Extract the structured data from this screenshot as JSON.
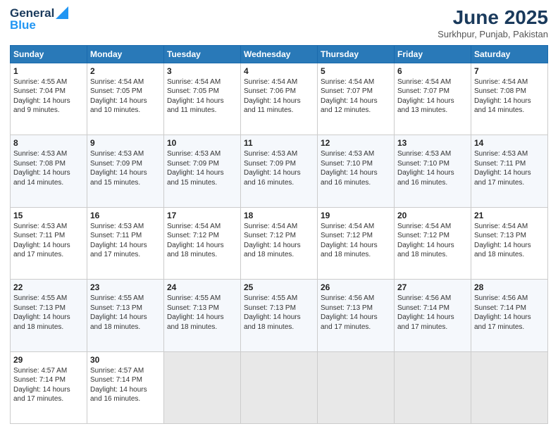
{
  "header": {
    "logo_line1": "General",
    "logo_line2": "Blue",
    "month": "June 2025",
    "location": "Surkhpur, Punjab, Pakistan"
  },
  "weekdays": [
    "Sunday",
    "Monday",
    "Tuesday",
    "Wednesday",
    "Thursday",
    "Friday",
    "Saturday"
  ],
  "weeks": [
    [
      {
        "day": "1",
        "sunrise": "4:55 AM",
        "sunset": "7:04 PM",
        "daylight": "14 hours and 9 minutes."
      },
      {
        "day": "2",
        "sunrise": "4:54 AM",
        "sunset": "7:05 PM",
        "daylight": "14 hours and 10 minutes."
      },
      {
        "day": "3",
        "sunrise": "4:54 AM",
        "sunset": "7:05 PM",
        "daylight": "14 hours and 11 minutes."
      },
      {
        "day": "4",
        "sunrise": "4:54 AM",
        "sunset": "7:06 PM",
        "daylight": "14 hours and 11 minutes."
      },
      {
        "day": "5",
        "sunrise": "4:54 AM",
        "sunset": "7:07 PM",
        "daylight": "14 hours and 12 minutes."
      },
      {
        "day": "6",
        "sunrise": "4:54 AM",
        "sunset": "7:07 PM",
        "daylight": "14 hours and 13 minutes."
      },
      {
        "day": "7",
        "sunrise": "4:54 AM",
        "sunset": "7:08 PM",
        "daylight": "14 hours and 14 minutes."
      }
    ],
    [
      {
        "day": "8",
        "sunrise": "4:53 AM",
        "sunset": "7:08 PM",
        "daylight": "14 hours and 14 minutes."
      },
      {
        "day": "9",
        "sunrise": "4:53 AM",
        "sunset": "7:09 PM",
        "daylight": "14 hours and 15 minutes."
      },
      {
        "day": "10",
        "sunrise": "4:53 AM",
        "sunset": "7:09 PM",
        "daylight": "14 hours and 15 minutes."
      },
      {
        "day": "11",
        "sunrise": "4:53 AM",
        "sunset": "7:09 PM",
        "daylight": "14 hours and 16 minutes."
      },
      {
        "day": "12",
        "sunrise": "4:53 AM",
        "sunset": "7:10 PM",
        "daylight": "14 hours and 16 minutes."
      },
      {
        "day": "13",
        "sunrise": "4:53 AM",
        "sunset": "7:10 PM",
        "daylight": "14 hours and 16 minutes."
      },
      {
        "day": "14",
        "sunrise": "4:53 AM",
        "sunset": "7:11 PM",
        "daylight": "14 hours and 17 minutes."
      }
    ],
    [
      {
        "day": "15",
        "sunrise": "4:53 AM",
        "sunset": "7:11 PM",
        "daylight": "14 hours and 17 minutes."
      },
      {
        "day": "16",
        "sunrise": "4:53 AM",
        "sunset": "7:11 PM",
        "daylight": "14 hours and 17 minutes."
      },
      {
        "day": "17",
        "sunrise": "4:54 AM",
        "sunset": "7:12 PM",
        "daylight": "14 hours and 18 minutes."
      },
      {
        "day": "18",
        "sunrise": "4:54 AM",
        "sunset": "7:12 PM",
        "daylight": "14 hours and 18 minutes."
      },
      {
        "day": "19",
        "sunrise": "4:54 AM",
        "sunset": "7:12 PM",
        "daylight": "14 hours and 18 minutes."
      },
      {
        "day": "20",
        "sunrise": "4:54 AM",
        "sunset": "7:12 PM",
        "daylight": "14 hours and 18 minutes."
      },
      {
        "day": "21",
        "sunrise": "4:54 AM",
        "sunset": "7:13 PM",
        "daylight": "14 hours and 18 minutes."
      }
    ],
    [
      {
        "day": "22",
        "sunrise": "4:55 AM",
        "sunset": "7:13 PM",
        "daylight": "14 hours and 18 minutes."
      },
      {
        "day": "23",
        "sunrise": "4:55 AM",
        "sunset": "7:13 PM",
        "daylight": "14 hours and 18 minutes."
      },
      {
        "day": "24",
        "sunrise": "4:55 AM",
        "sunset": "7:13 PM",
        "daylight": "14 hours and 18 minutes."
      },
      {
        "day": "25",
        "sunrise": "4:55 AM",
        "sunset": "7:13 PM",
        "daylight": "14 hours and 18 minutes."
      },
      {
        "day": "26",
        "sunrise": "4:56 AM",
        "sunset": "7:13 PM",
        "daylight": "14 hours and 17 minutes."
      },
      {
        "day": "27",
        "sunrise": "4:56 AM",
        "sunset": "7:14 PM",
        "daylight": "14 hours and 17 minutes."
      },
      {
        "day": "28",
        "sunrise": "4:56 AM",
        "sunset": "7:14 PM",
        "daylight": "14 hours and 17 minutes."
      }
    ],
    [
      {
        "day": "29",
        "sunrise": "4:57 AM",
        "sunset": "7:14 PM",
        "daylight": "14 hours and 17 minutes."
      },
      {
        "day": "30",
        "sunrise": "4:57 AM",
        "sunset": "7:14 PM",
        "daylight": "14 hours and 16 minutes."
      },
      null,
      null,
      null,
      null,
      null
    ]
  ],
  "labels": {
    "sunrise": "Sunrise:",
    "sunset": "Sunset:",
    "daylight": "Daylight:"
  }
}
